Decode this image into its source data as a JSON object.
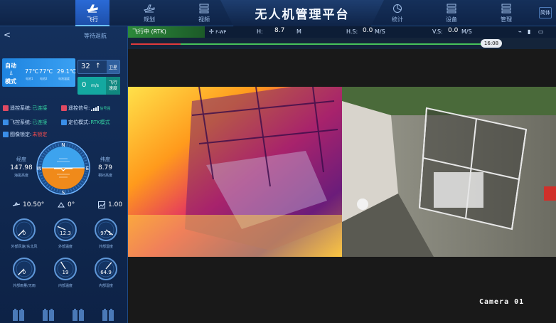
{
  "title": "无人机管理平台",
  "nav": {
    "items": [
      {
        "label": "飞行",
        "icon": "plane-icon",
        "active": true
      },
      {
        "label": "规划",
        "icon": "plane-outline-icon",
        "active": false
      },
      {
        "label": "视频",
        "icon": "list-icon",
        "active": false
      },
      {
        "label": "统计",
        "icon": "pie-chart-icon",
        "active": false
      },
      {
        "label": "设备",
        "icon": "device-list-icon",
        "active": false
      },
      {
        "label": "管理",
        "icon": "manage-list-icon",
        "active": false
      }
    ],
    "lang": "简体"
  },
  "left": {
    "back": "<",
    "status": "等待返航",
    "mode_top": "自动",
    "mode_bottom": "模式",
    "mode_temp1": "77℃",
    "mode_temp1_sub": "电池1",
    "mode_temp2": "77℃",
    "mode_temp2_sub": "电池2",
    "mode_temp3": "29.1℃",
    "mode_temp3_sub": "电池温度",
    "satellites": "32",
    "satellites_label": "卫星",
    "speed": "0",
    "speed_unit": "m/s",
    "speed_label_1": "飞行",
    "speed_label_2": "速度",
    "systems": [
      {
        "label": "遥控系统:",
        "value": "已连接",
        "state": "ok"
      },
      {
        "label": "遥控信号:",
        "value": "",
        "extra": "信号强",
        "state": "ok"
      },
      {
        "label": "飞控系统:",
        "value": "已连接",
        "state": "ok"
      },
      {
        "label": "定位模式:",
        "value": "RTK模式",
        "state": "ok"
      },
      {
        "label": "图像锁定:",
        "value": "未锁定",
        "state": "bad"
      }
    ],
    "hud": {
      "left_label": "经度",
      "left_value": "147.98",
      "left_sub": "海拔高度",
      "right_label": "纬度",
      "right_value": "8.79",
      "right_sub": "相对高度",
      "dirs": [
        "N",
        "E",
        "S",
        "W"
      ]
    },
    "angles": [
      {
        "value": "10.50°",
        "icon": "pitch-icon"
      },
      {
        "value": "0°",
        "icon": "yaw-icon"
      },
      {
        "value": "1.00",
        "icon": "image-icon"
      }
    ],
    "gauges": [
      {
        "value": "0",
        "caption": "外部风速/东北风",
        "fraction": 0.0
      },
      {
        "value": "12.3",
        "caption": "外部温度",
        "fraction": 0.25
      },
      {
        "value": "97.1",
        "caption": "外部湿度",
        "fraction": 0.97
      },
      {
        "value": "0",
        "caption": "外部雨量/无雨",
        "fraction": 0.0
      },
      {
        "value": "19",
        "caption": "内部温度",
        "fraction": 0.38
      },
      {
        "value": "64.9",
        "caption": "内部湿度",
        "fraction": 0.65
      }
    ]
  },
  "telemetry": {
    "flight_state": "飞行中 (RTK)",
    "flight_mode": "F-WP",
    "h_label": "H:",
    "h_value": "8.7",
    "h_unit": "M",
    "hs_label": "H.S:",
    "hs_value": "0.0",
    "hs_unit": "M/S",
    "vs_label": "V.S:",
    "vs_value": "0.0",
    "vs_unit": "M/S",
    "time": "16:08"
  },
  "video": {
    "camera_label": "Camera 01"
  }
}
